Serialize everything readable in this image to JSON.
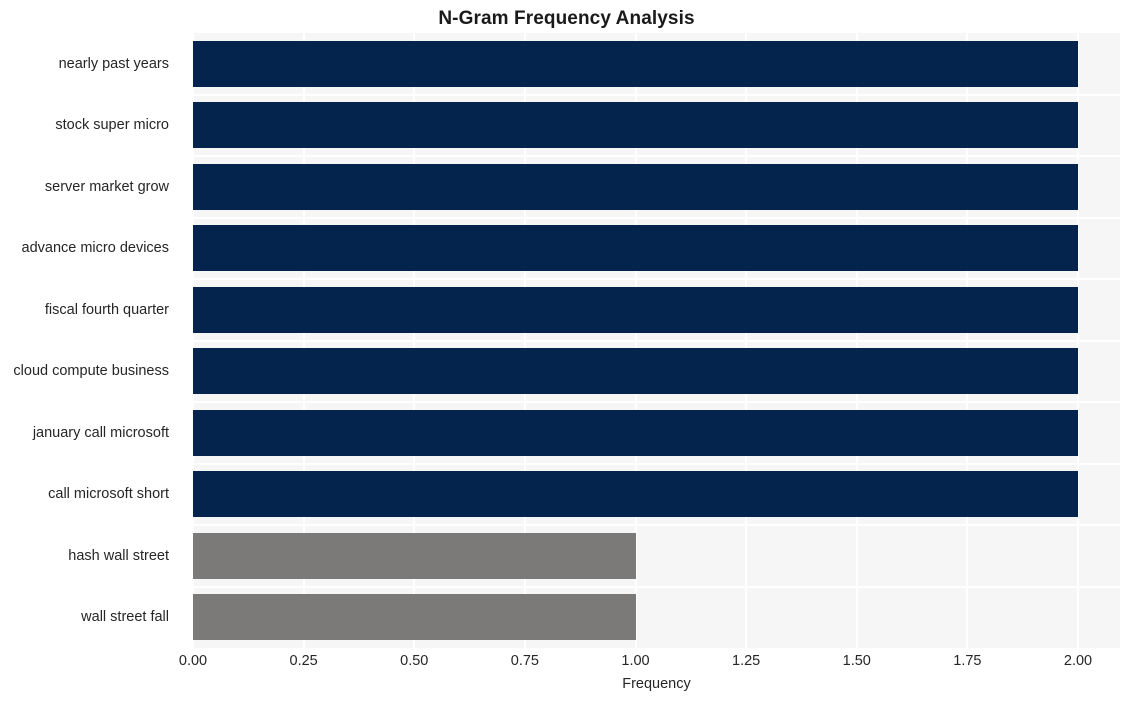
{
  "chart_data": {
    "type": "bar",
    "orientation": "horizontal",
    "title": "N-Gram Frequency Analysis",
    "xlabel": "Frequency",
    "ylabel": "",
    "categories": [
      "nearly past years",
      "stock super micro",
      "server market grow",
      "advance micro devices",
      "fiscal fourth quarter",
      "cloud compute business",
      "january call microsoft",
      "call microsoft short",
      "hash wall street",
      "wall street fall"
    ],
    "values": [
      2,
      2,
      2,
      2,
      2,
      2,
      2,
      2,
      1,
      1
    ],
    "bar_colors": [
      "#04244d",
      "#04244d",
      "#04244d",
      "#04244d",
      "#04244d",
      "#04244d",
      "#04244d",
      "#04244d",
      "#7c7a78",
      "#7c7a78"
    ],
    "xlim": [
      0,
      2
    ],
    "xticks": [
      0,
      0.25,
      0.5,
      0.75,
      1,
      1.25,
      1.5,
      1.75,
      2
    ],
    "xtick_labels": [
      "0.00",
      "0.25",
      "0.50",
      "0.75",
      "1.00",
      "1.25",
      "1.50",
      "1.75",
      "2.00"
    ],
    "grid": true,
    "grid_color": "#ffffff",
    "plot_background": "#f6f6f6",
    "figure_background": "#ffffff",
    "legend": null,
    "accent_color": "#04244d",
    "secondary_color": "#7c7a78"
  }
}
